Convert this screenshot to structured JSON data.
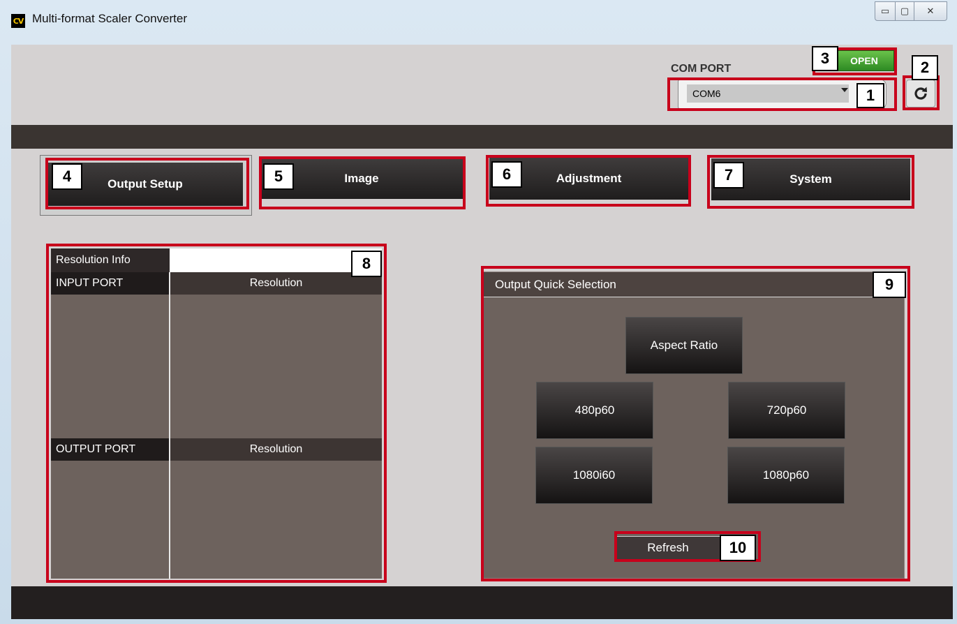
{
  "window": {
    "icon_text": "CV",
    "title": "Multi-format Scaler Converter",
    "controls": {
      "minimize": "▭",
      "maximize": "▢",
      "close": "✕"
    }
  },
  "com": {
    "label": "COM PORT",
    "selected_port": "COM6",
    "open_label": "OPEN",
    "refresh_icon": "refresh-icon"
  },
  "tabs": [
    {
      "label": "Output Setup",
      "selected": true
    },
    {
      "label": "Image"
    },
    {
      "label": "Adjustment"
    },
    {
      "label": "System"
    }
  ],
  "resolution_info": {
    "title": "Resolution Info",
    "input_port_header": "INPUT PORT",
    "input_resolution_header": "Resolution",
    "output_port_header": "OUTPUT PORT",
    "output_resolution_header": "Resolution"
  },
  "output_quick_selection": {
    "title": "Output Quick Selection",
    "aspect_ratio": "Aspect Ratio",
    "buttons": [
      "480p60",
      "720p60",
      "1080i60",
      "1080p60"
    ],
    "refresh": "Refresh"
  },
  "callouts": [
    "1",
    "2",
    "3",
    "4",
    "5",
    "6",
    "7",
    "8",
    "9",
    "10"
  ],
  "colors": {
    "callout_border": "#c8001b",
    "open_green": "#2d8a23"
  }
}
